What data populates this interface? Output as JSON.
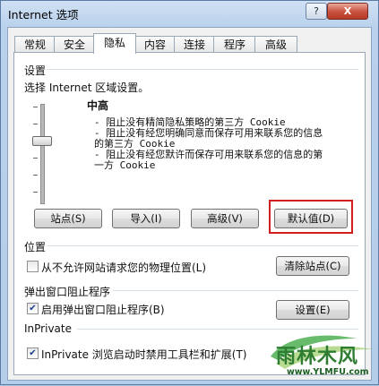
{
  "window": {
    "title": "Internet 选项",
    "help_label": "?",
    "close_label": "X"
  },
  "tabs": [
    {
      "label": "常规"
    },
    {
      "label": "安全"
    },
    {
      "label": "隐私",
      "active": true
    },
    {
      "label": "内容"
    },
    {
      "label": "连接"
    },
    {
      "label": "程序"
    },
    {
      "label": "高级"
    }
  ],
  "settings": {
    "group_title": "设置",
    "prompt": "选择 Internet 区域设置。",
    "level": "中高",
    "desc_lines": [
      "- 阻止没有精简隐私策略的第三方 Cookie",
      "- 阻止没有经您明确同意而保存可用来联系您的信息",
      "的第三方 Cookie",
      "- 阻止没有经您默许而保存可用来联系您的信息的第",
      "一方 Cookie"
    ],
    "buttons": {
      "sites": "站点(S)",
      "import": "导入(I)",
      "advanced": "高级(V)",
      "default": "默认值(D)"
    }
  },
  "location": {
    "group_title": "位置",
    "checkbox_label": "从不允许网站请求您的物理位置(L)",
    "checked": false,
    "clear_button": "清除站点(C)"
  },
  "popup": {
    "group_title": "弹出窗口阻止程序",
    "checkbox_label": "启用弹出窗口阻止程序(B)",
    "checked": true,
    "settings_button": "设置(E)"
  },
  "inprivate": {
    "group_title": "InPrivate",
    "checkbox_label": "InPrivate 浏览启动时禁用工具栏和扩展(T)",
    "checked": true
  },
  "watermark": {
    "text": "雨林木风",
    "url": "www.YLMFU.com"
  },
  "colors": {
    "highlight": "#d11f1f",
    "titlebar": "#b9d1ec",
    "watermark_green": "#2e7d32"
  }
}
